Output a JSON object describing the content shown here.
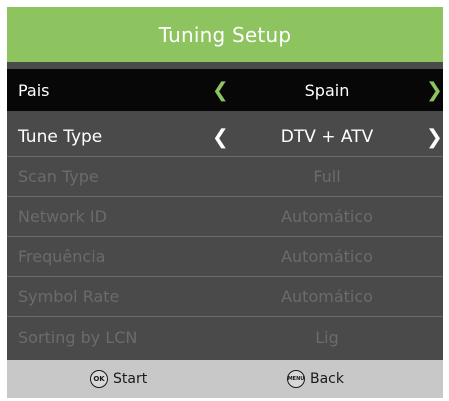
{
  "header": {
    "title": "Tuning Setup"
  },
  "menu": [
    {
      "label": "Pais",
      "value": "Spain",
      "arrows": true
    },
    {
      "label": "Tune Type",
      "value": "DTV + ATV",
      "arrows": true
    },
    {
      "label": "Scan Type",
      "value": "Full",
      "arrows": false
    },
    {
      "label": "Network ID",
      "value": "Automático",
      "arrows": false
    },
    {
      "label": "Frequência",
      "value": "Automático",
      "arrows": false
    },
    {
      "label": "Symbol Rate",
      "value": "Automático",
      "arrows": false
    },
    {
      "label": "Sorting by LCN",
      "value": "Lig",
      "arrows": false
    }
  ],
  "footer": {
    "start": {
      "icon_text": "OK",
      "label": "Start"
    },
    "back": {
      "icon_text": "MENU",
      "label": "Back"
    }
  },
  "arrows": {
    "left": "❮",
    "right": "❯"
  },
  "colors": {
    "accent": "#8dc460",
    "panel": "#4a4a4a",
    "selected_row": "#070707",
    "footer": "#c8c8c8",
    "disabled_text": "#6b6b6b"
  }
}
